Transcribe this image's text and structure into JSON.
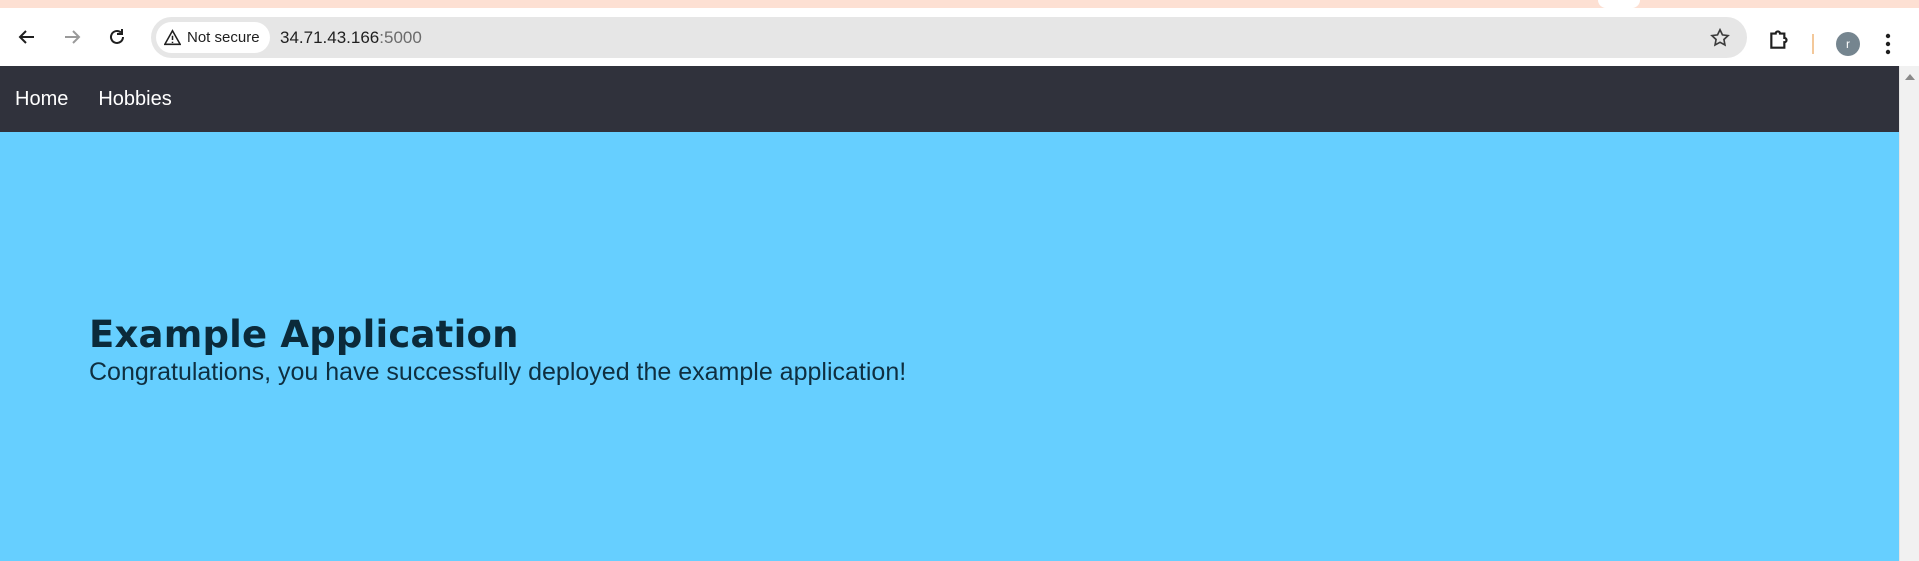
{
  "browser": {
    "security_label": "Not secure",
    "url_host": "34.71.43.166",
    "url_port": ":5000",
    "avatar_initial": "r",
    "icons": [
      "back-arrow-icon",
      "forward-arrow-icon",
      "reload-icon",
      "warning-triangle-icon",
      "star-icon",
      "extensions-puzzle-icon",
      "kebab-menu-icon"
    ]
  },
  "site": {
    "nav": [
      {
        "label": "Home"
      },
      {
        "label": "Hobbies"
      }
    ],
    "hero": {
      "title": "Example Application",
      "subtitle": "Congratulations, you have successfully deployed the example application!"
    }
  },
  "colors": {
    "nav_bg": "#30323c",
    "hero_bg": "#66cfff",
    "tabstrip": "#fde0d3"
  }
}
